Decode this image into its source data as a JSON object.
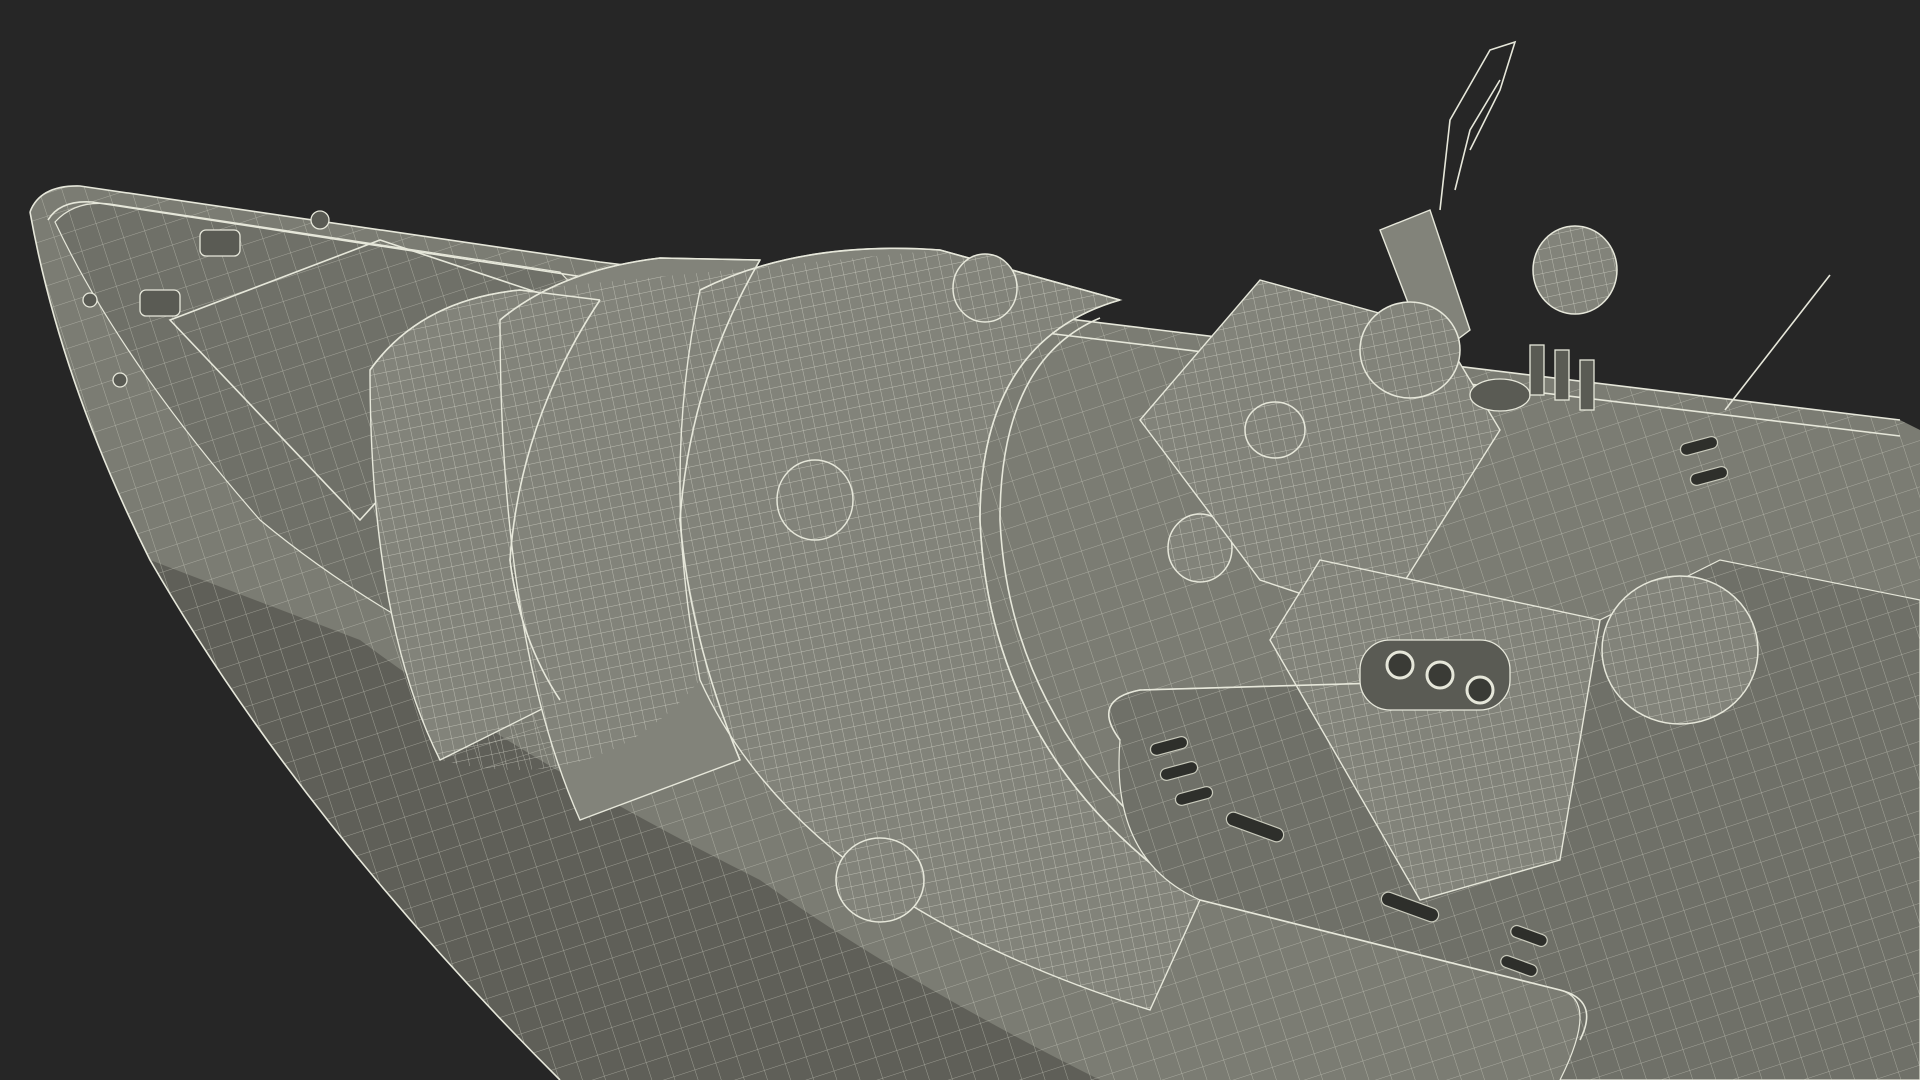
{
  "viewport": {
    "subject": "wireframe-render-yacht-bow-top-view",
    "colors": {
      "background": "#262626",
      "hull_fill": "#7b7c73",
      "deck_fill": "#6f7068",
      "superstructure_fill": "#82837a",
      "shadow_fill": "#5a5b54",
      "wire": "#e6e7da",
      "wire_dim": "#c9cabc"
    }
  }
}
